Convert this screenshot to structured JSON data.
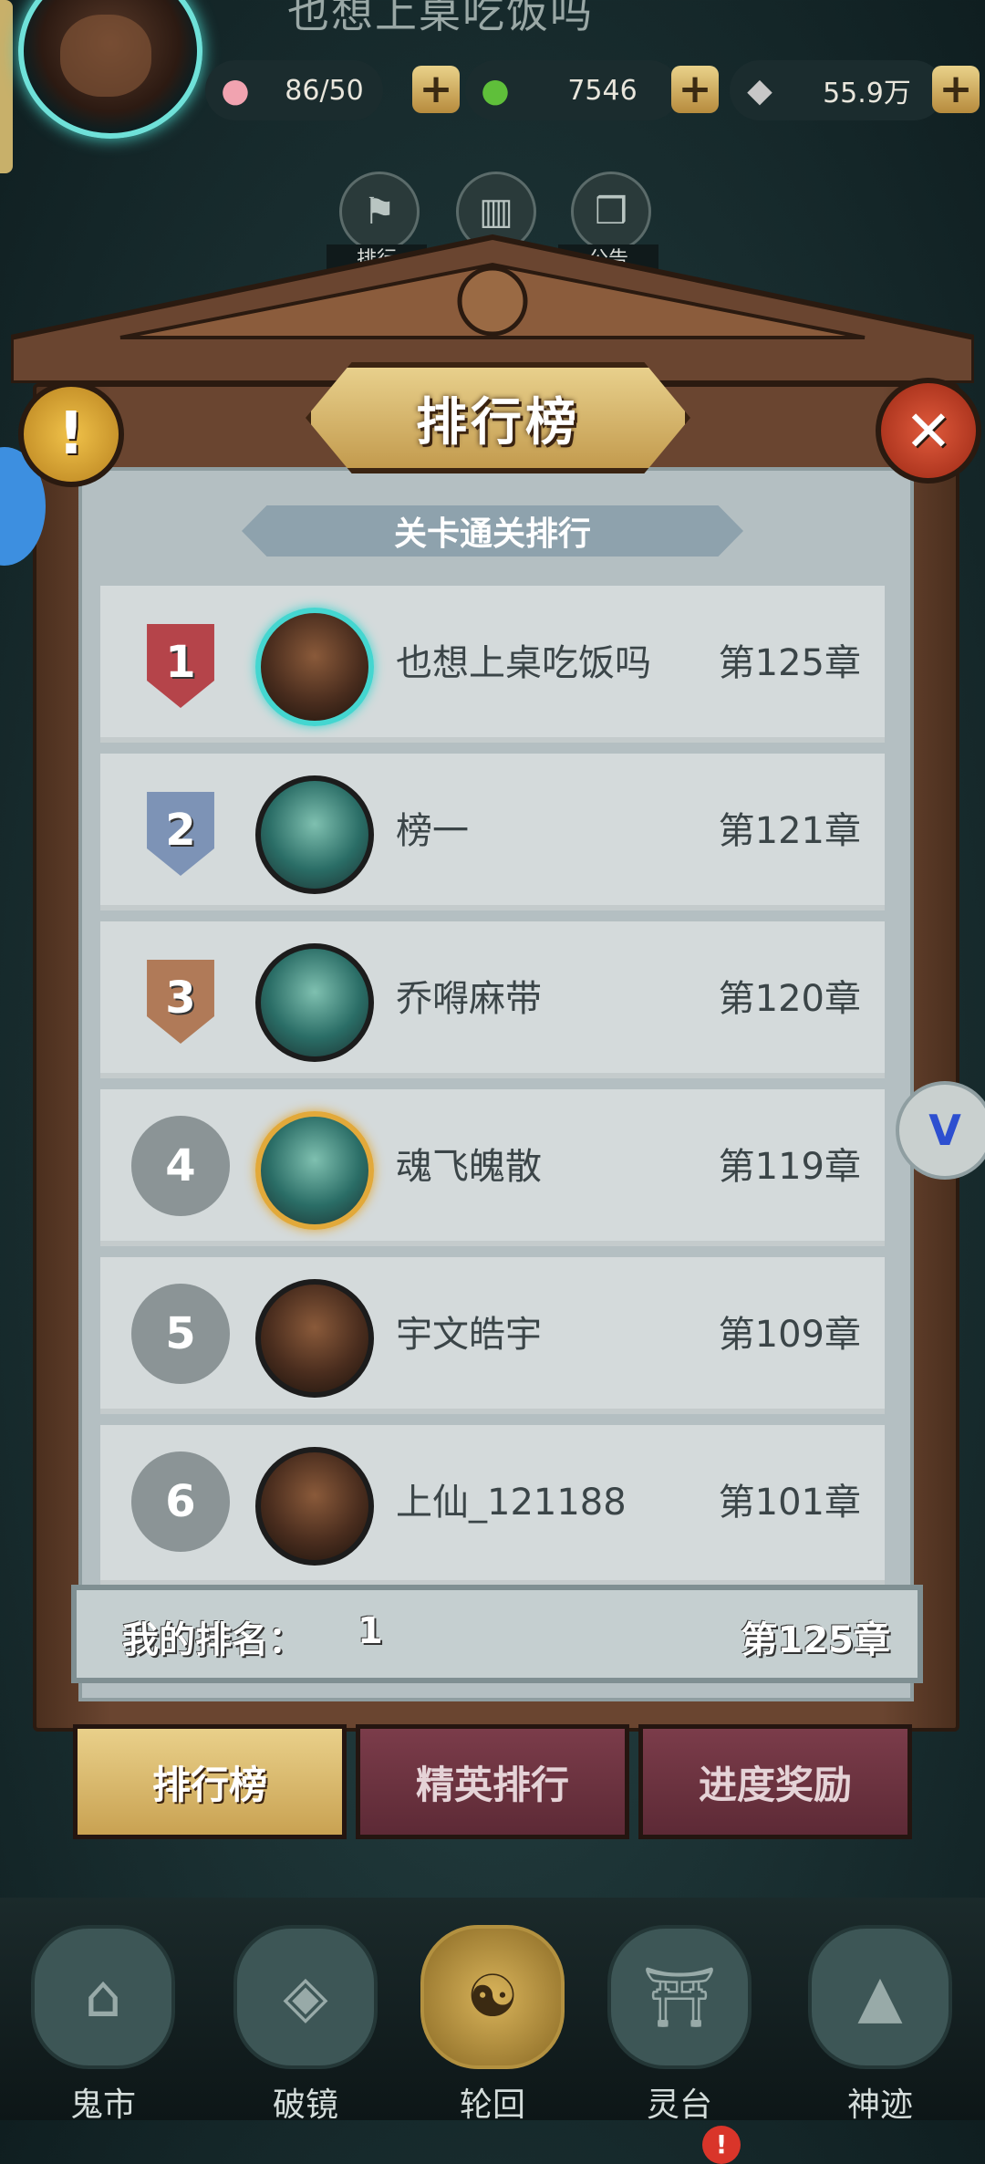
{
  "header": {
    "player_name": "也想上桌吃饭吗",
    "resources": [
      {
        "icon": "peach-icon",
        "value": "86/50"
      },
      {
        "icon": "jade-dragon-icon",
        "value": "7546"
      },
      {
        "icon": "coin-icon",
        "value": "55.9万"
      }
    ],
    "top_icons": [
      {
        "icon": "ranking-flag-icon",
        "label": "排行"
      },
      {
        "icon": "book-icon",
        "label": ""
      },
      {
        "icon": "scroll-icon",
        "label": "公告"
      }
    ]
  },
  "panel": {
    "title": "排行榜",
    "subtitle": "关卡通关排行",
    "info_glyph": "!",
    "close_glyph": "✕",
    "rows": [
      {
        "rank": "1",
        "name": "也想上桌吃饭吗",
        "chapter": "第125章"
      },
      {
        "rank": "2",
        "name": "榜一",
        "chapter": "第121章"
      },
      {
        "rank": "3",
        "name": "乔嘚麻带",
        "chapter": "第120章"
      },
      {
        "rank": "4",
        "name": "魂飞魄散",
        "chapter": "第119章"
      },
      {
        "rank": "5",
        "name": "宇文皓宇",
        "chapter": "第109章"
      },
      {
        "rank": "6",
        "name": "上仙_121188",
        "chapter": "第101章"
      }
    ],
    "my_rank": {
      "label": "我的排名：",
      "value": "1",
      "chapter": "第125章"
    }
  },
  "subtabs": [
    {
      "label": "排行榜",
      "active": true
    },
    {
      "label": "精英排行",
      "active": false
    },
    {
      "label": "进度奖励",
      "active": false
    }
  ],
  "bottom_nav": [
    {
      "label": "鬼市",
      "icon": "market-icon"
    },
    {
      "label": "破镜",
      "icon": "broken-mirror-icon"
    },
    {
      "label": "轮回",
      "icon": "yin-yang-icon"
    },
    {
      "label": "灵台",
      "icon": "pavilion-icon",
      "badge": "!"
    },
    {
      "label": "神迹",
      "icon": "mountain-icon"
    }
  ],
  "floating": {
    "right_badge": "V"
  },
  "colors": {
    "gold": "#c9a252",
    "wood": "#6a4530",
    "panel": "#b4bfc2"
  }
}
